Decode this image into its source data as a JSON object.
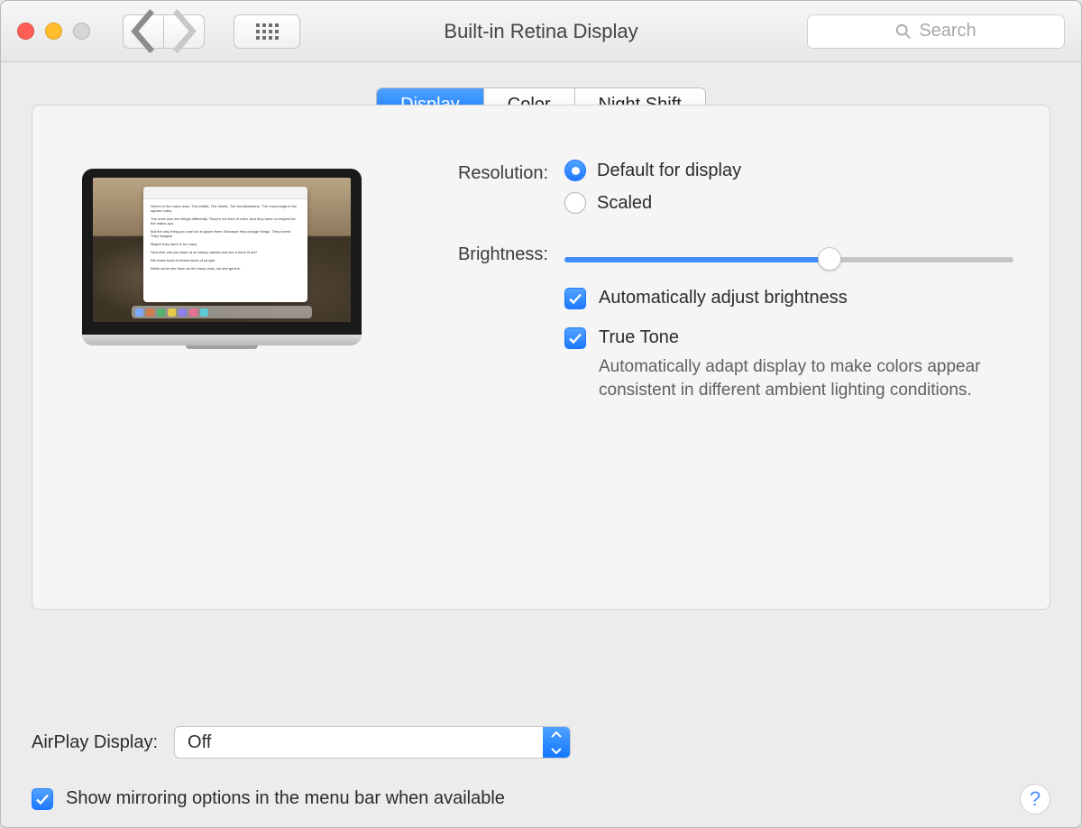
{
  "window": {
    "title": "Built-in Retina Display",
    "search_placeholder": "Search"
  },
  "tabs": [
    "Display",
    "Color",
    "Night Shift"
  ],
  "selected_tab": "Display",
  "resolution": {
    "label": "Resolution:",
    "options": [
      "Default for display",
      "Scaled"
    ],
    "selected": "Default for display"
  },
  "brightness": {
    "label": "Brightness:",
    "value_percent": 59
  },
  "auto_brightness": {
    "label": "Automatically adjust brightness",
    "checked": true
  },
  "true_tone": {
    "label": "True Tone",
    "checked": true,
    "description": "Automatically adapt display to make colors appear consistent in different ambient lighting conditions."
  },
  "airplay": {
    "label": "AirPlay Display:",
    "value": "Off"
  },
  "mirroring": {
    "label": "Show mirroring options in the menu bar when available",
    "checked": true
  },
  "help_glyph": "?"
}
